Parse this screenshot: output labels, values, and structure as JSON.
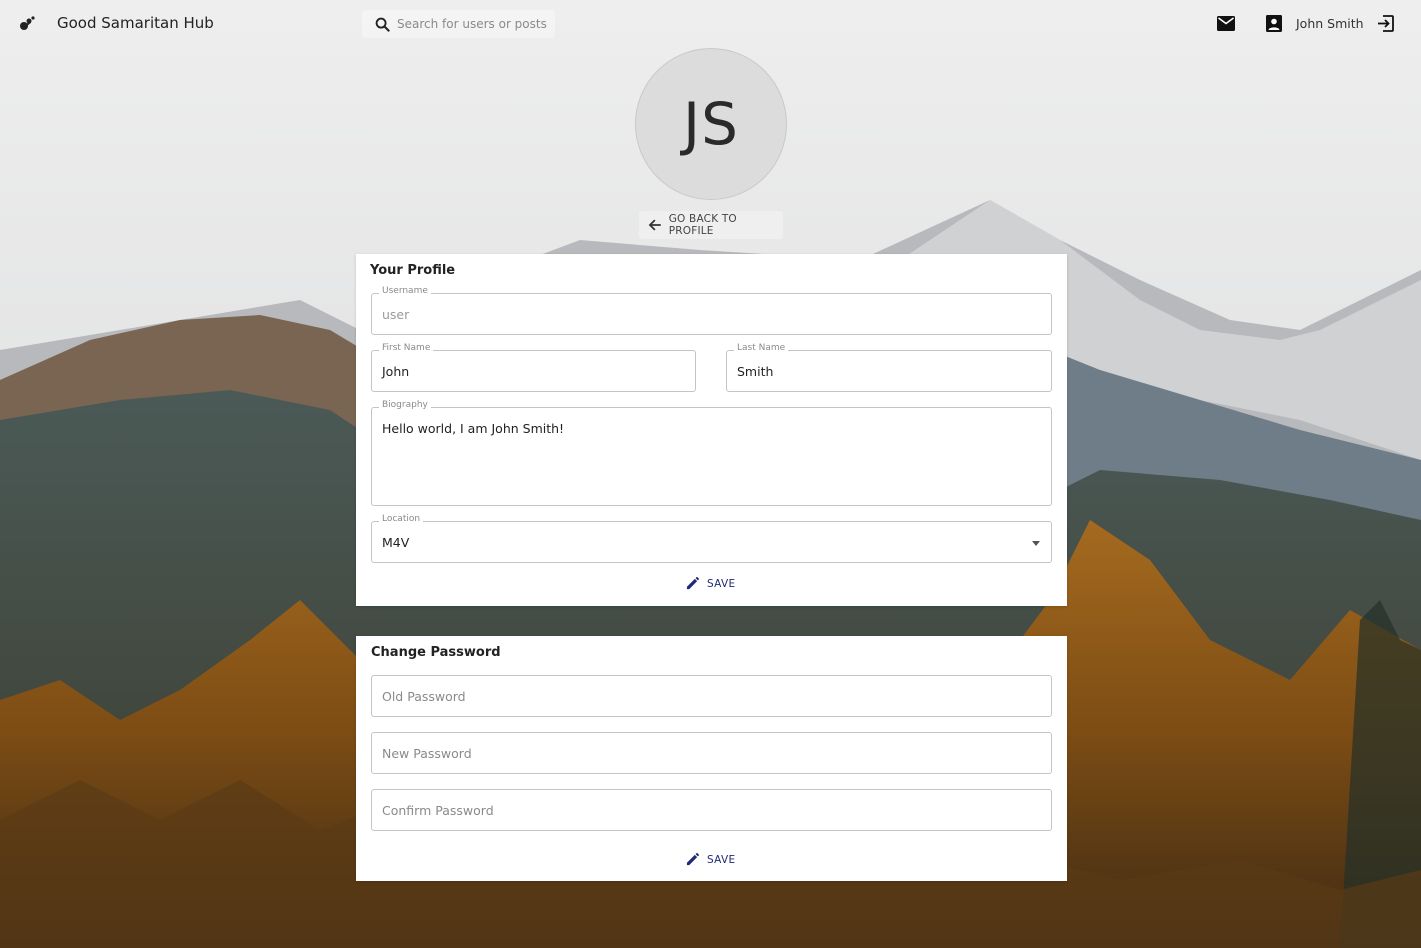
{
  "app": {
    "title": "Good Samaritan Hub"
  },
  "search": {
    "placeholder": "Search for users or posts"
  },
  "header": {
    "user_name": "John Smith"
  },
  "avatar": {
    "initials": "JS"
  },
  "back_button": {
    "label": "GO BACK TO PROFILE"
  },
  "profile_card": {
    "title": "Your Profile",
    "username": {
      "label": "Username",
      "value": "user"
    },
    "first_name": {
      "label": "First Name",
      "value": "John"
    },
    "last_name": {
      "label": "Last Name",
      "value": "Smith"
    },
    "biography": {
      "label": "Biography",
      "value": "Hello world, I am John Smith!"
    },
    "location": {
      "label": "Location",
      "value": "M4V"
    },
    "save_label": "SAVE"
  },
  "password_card": {
    "title": "Change Password",
    "old_password": {
      "placeholder": "Old Password"
    },
    "new_password": {
      "placeholder": "New Password"
    },
    "confirm_password": {
      "placeholder": "Confirm Password"
    },
    "save_label": "SAVE"
  },
  "colors": {
    "accent": "#1e2a78",
    "card_bg": "#ffffff",
    "border": "#c4c4c4"
  }
}
